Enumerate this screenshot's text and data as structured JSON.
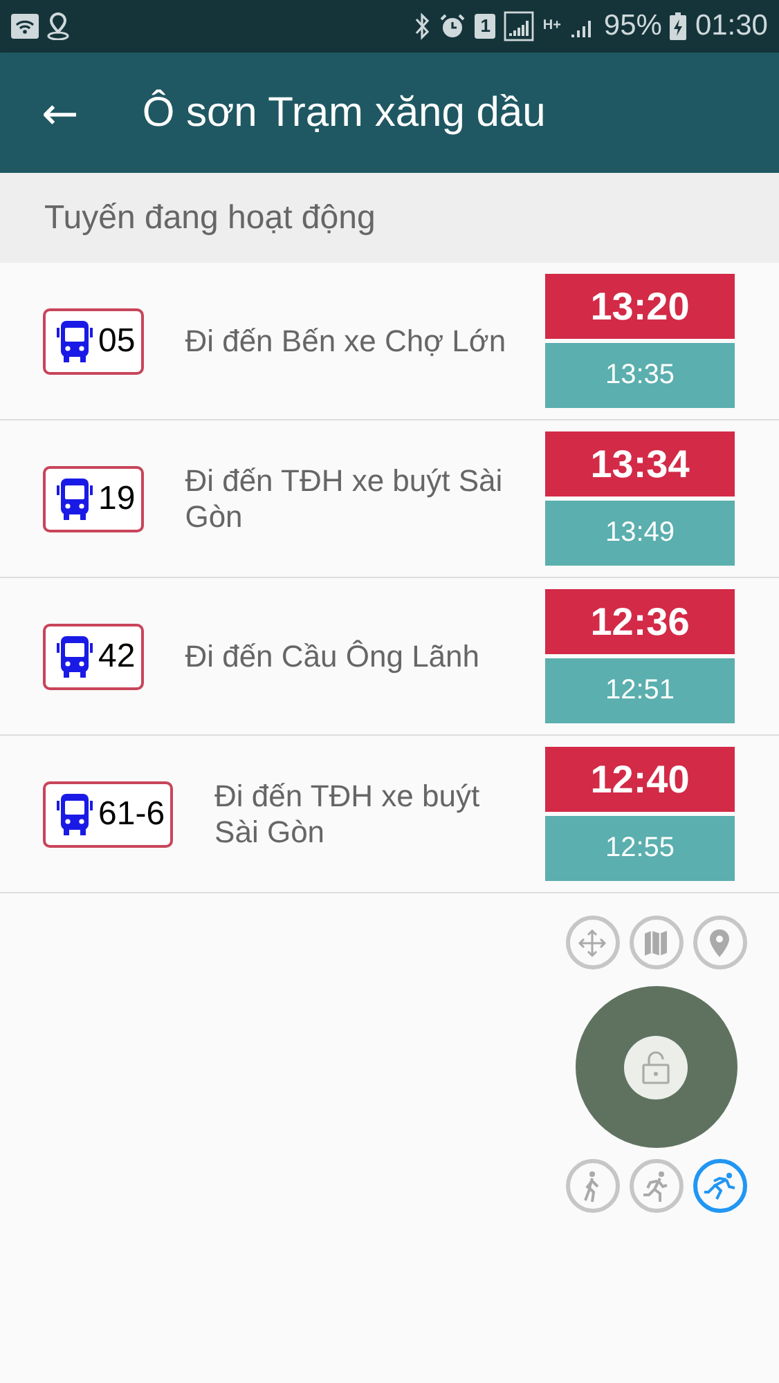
{
  "status_bar": {
    "sim": "1",
    "network": "H+",
    "battery": "95%",
    "time": "01:30"
  },
  "toolbar": {
    "back": "←",
    "title": "Ô sơn Trạm xăng dầu"
  },
  "section": {
    "title": "Tuyến đang hoạt động"
  },
  "routes": [
    {
      "number": "05",
      "destination": "Đi đến Bến xe Chợ Lớn",
      "next": "13:20",
      "after": "13:35"
    },
    {
      "number": "19",
      "destination": "Đi đến TĐH xe buýt Sài Gòn",
      "next": "13:34",
      "after": "13:49"
    },
    {
      "number": "42",
      "destination": "Đi đến Cầu Ông Lãnh",
      "next": "12:36",
      "after": "12:51"
    },
    {
      "number": "61-6",
      "destination": "Đi đến TĐH xe buýt Sài Gòn",
      "next": "12:40",
      "after": "12:55"
    }
  ],
  "speed_modes": [
    {
      "kind": "walk",
      "selected": false
    },
    {
      "kind": "jog",
      "selected": false
    },
    {
      "kind": "run",
      "selected": true
    }
  ]
}
